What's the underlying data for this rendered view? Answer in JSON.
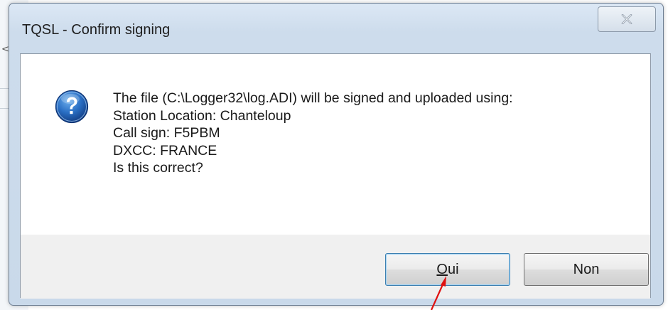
{
  "background": {
    "glyph": "<"
  },
  "dialog": {
    "title": "TQSL - Confirm signing",
    "close_icon": "close-x-icon",
    "icon": "question-icon",
    "message_lines": [
      "The file (C:\\Logger32\\log.ADI) will be signed and uploaded using:",
      "Station Location: Chanteloup",
      "Call sign: F5PBM",
      "DXCC: FRANCE",
      "Is this correct?"
    ],
    "buttons": {
      "yes_accel": "O",
      "yes_rest": "ui",
      "no_label": "Non"
    }
  },
  "annotation": {
    "arrow_color": "#e01010"
  },
  "colors": {
    "default_button_border": "#3c7fb1",
    "window_frame": "#cddcec"
  }
}
